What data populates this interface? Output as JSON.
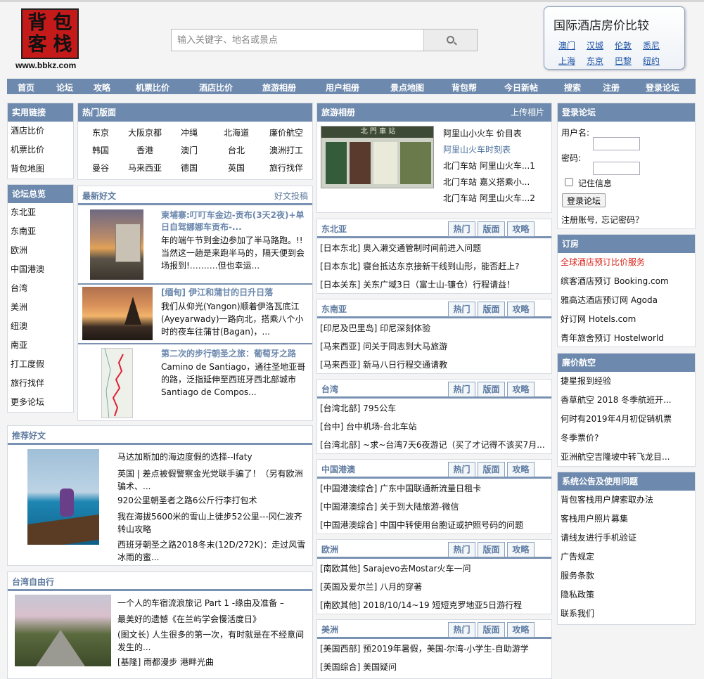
{
  "logo": {
    "c1": "背",
    "c2": "包",
    "c3": "客",
    "c4": "栈",
    "url": "www.bbkz.com"
  },
  "search": {
    "placeholder": "输入关键字、地名或景点"
  },
  "hotel_compare": {
    "title": "国际酒店房价比较",
    "cities": [
      "澳门",
      "汉城",
      "伦敦",
      "悉尼",
      "上海",
      "东京",
      "巴黎",
      "纽约"
    ]
  },
  "nav": [
    "首页",
    "论坛",
    "攻略",
    "机票比价",
    "酒店比价",
    "旅游相册",
    "用户相册",
    "景点地图",
    "背包帮",
    "今日新帖",
    "搜索",
    "注册",
    "登录论坛"
  ],
  "useful": {
    "title": "实用链接",
    "items": [
      "酒店比价",
      "机票比价",
      "背包地图"
    ]
  },
  "forums": {
    "title": "论坛总览",
    "items": [
      "东北亚",
      "东南亚",
      "欧洲",
      "中国港澳",
      "台湾",
      "美洲",
      "纽澳",
      "南亚",
      "打工度假",
      "旅行找伴",
      "更多论坛"
    ]
  },
  "hot": {
    "title": "热门版面",
    "items": [
      "东京",
      "大阪京都",
      "冲绳",
      "北海道",
      "廉价航空",
      "韩国",
      "香港",
      "澳门",
      "台北",
      "澳洲打工",
      "曼谷",
      "马来西亚",
      "德国",
      "英国",
      "旅行找伴"
    ]
  },
  "latest": {
    "title": "最新好文",
    "more": "好文投稿",
    "articles": [
      {
        "title": "柬埔寨:叮叮车金边-贡布(3天2夜)+单日自驾娜娜车贡布-...",
        "body": "年的端午节到金边参加了半马路跑。!!当然这一趟是来跑半马的，隔天便到会场报到!……….但也幸运..."
      },
      {
        "title": "[缅甸] 伊江和蒲甘的日升日落",
        "body": "我们从仰光(Yangon)顺着伊洛瓦底江(Ayeyarwady)一路向北，搭乘八个小时的夜车往蒲甘(Bagan)，..."
      },
      {
        "title": "第二次的步行朝圣之旅：葡萄牙之路",
        "body": "Camino de Santiago，通往圣地亚哥的路，泛指延伸至西班牙西北部城市Santiago de Compos..."
      }
    ]
  },
  "recommend": {
    "title": "推荐好文",
    "items": [
      "马达加斯加的海边度假的选择--Ifaty",
      "英国 | 差点被假警察金光党联手骗了！（另有欧洲骗术、...",
      "920公里朝圣者之路6公斤行李打包术",
      "我在海拔5600米的雪山上徒步52公里---冈仁波齐转山攻略",
      "西班牙朝圣之路2018冬末(12D/272K)：走过风雪冰雨的蜜..."
    ]
  },
  "taiwan_free": {
    "title": "台湾自由行",
    "items": [
      "一个人的车宿流浪旅记 Part 1 -缘由及准备 –",
      "最美好的遗憾《在兰屿学会慢活度日》",
      "(图文长) 人生很多的第一次，有时就是在不经意间发生的...",
      "[基隆] 雨都漫步 港畔光曲"
    ]
  },
  "album": {
    "title": "旅游相册",
    "upload": "上传相片",
    "links": [
      "阿里山小火车 价目表",
      "阿里山火车时刻表",
      "北门车站 阿里山火车...1",
      "北门车站 嘉义搭乘小...",
      "北门车站 阿里山火车...2"
    ],
    "photo_text": "北 門 車 站"
  },
  "tab_labels": [
    "热门",
    "版面",
    "攻略"
  ],
  "sections": [
    {
      "title": "东北亚",
      "rows": [
        "[日本东北] 奥入濑交通管制时间前进入问题",
        "[日本东北] 寝台抵达东京接新干线到山形，能否赶上?",
        "[日本关东] 关东广域3日（富士山-镰仓）行程请益！"
      ]
    },
    {
      "title": "东南亚",
      "rows": [
        "[印尼及巴里岛] 印尼深刻体验",
        "[马来西亚] 问关于同志到大马旅游",
        "[马来西亚] 新马八日行程交通请教"
      ]
    },
    {
      "title": "台湾",
      "rows": [
        "[台湾北部] 795公车",
        "[台中] 台中机场-台北车站",
        "[台湾北部] ~求~台湾7天6夜游记（买了才记得不该买7月..."
      ]
    },
    {
      "title": "中国港澳",
      "rows": [
        "[中国港澳综合] 广东中国联通新流量日租卡",
        "[中国港澳综合] 关于到大陆旅游-微信",
        "[中国港澳综合] 中国中转使用台胞证或护照号码的问题"
      ]
    },
    {
      "title": "欧洲",
      "rows": [
        "[南欧其他] Sarajevo去Mostar火车一问",
        "[英国及爱尔兰] 八月的穿著",
        "[南欧其他] 2018/10/14~19 短短克罗地亚5日游行程"
      ]
    },
    {
      "title": "美洲",
      "rows": [
        "[美国西部] 预2019年暑假，美国-尔湾-小学生-自助游学",
        "[美国综合] 美国疑问"
      ]
    }
  ],
  "login": {
    "title": "登录论坛",
    "username": "用户名:",
    "password": "密码:",
    "remember": "记住信息",
    "button": "登录论坛",
    "register": "注册账号,",
    "forgot": "忘记密码？"
  },
  "booking": {
    "title": "订房",
    "items": [
      "全球酒店预订比价服务",
      "缤客酒店预订 Booking.com",
      "雅高达酒店预订网 Agoda",
      "好订网 Hotels.com",
      "青年旅舍预订 Hostelworld"
    ],
    "highlight_color": "#d9261c"
  },
  "lowcost": {
    "title": "廉价航空",
    "items": [
      "捷星报到经验",
      "香草航空 2018 冬季航班开...",
      "何时有2019年4月初促销机票",
      "冬季票价?",
      "亚洲航空吉隆坡中转飞龙目..."
    ]
  },
  "notice": {
    "title": "系统公告及使用问题",
    "items": [
      "背包客栈用户牌索取办法",
      "客栈用户照片募集",
      "请线友进行手机验证",
      "广告规定",
      "服务条款",
      "隐私政策",
      "联系我们"
    ]
  },
  "colors": {
    "nav": "#6d89ad",
    "link": "#1d52a5",
    "article_title": "#6c88ad"
  }
}
